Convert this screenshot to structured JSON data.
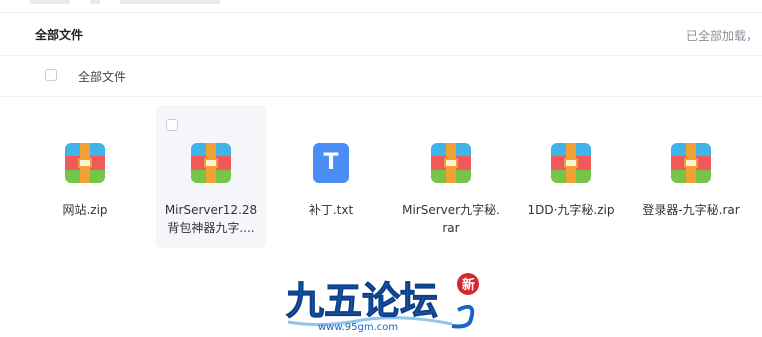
{
  "header": {
    "title": "全部文件",
    "status": "已全部加载，"
  },
  "list_header": {
    "label": "全部文件"
  },
  "files": [
    {
      "name": "网站.zip",
      "icon": "zip-archive-icon"
    },
    {
      "name": "MirServer12.28背包神器九字....",
      "icon": "zip-archive-icon"
    },
    {
      "name": "补丁.txt",
      "icon": "text-file-icon",
      "glyph": "T"
    },
    {
      "name": "MirServer九字秘.rar",
      "icon": "zip-archive-icon"
    },
    {
      "name": "1DD·九字秘.zip",
      "icon": "zip-archive-icon"
    },
    {
      "name": "登录器-九字秘.rar",
      "icon": "zip-archive-icon"
    }
  ],
  "watermark": {
    "main": "九五论坛",
    "url": "www.95gm.com",
    "seal": "新"
  },
  "colors": {
    "txt_icon": "#4a8df5",
    "watermark_blue": "#1b64c7"
  }
}
